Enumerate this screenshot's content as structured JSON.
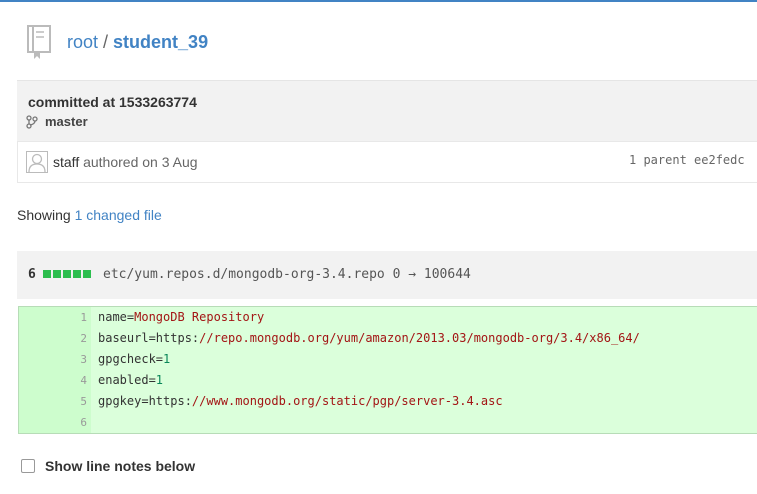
{
  "header": {
    "root": "root",
    "separator": "/",
    "repo": "student_39"
  },
  "commit": {
    "title": "committed at 1533263774",
    "branch": "master"
  },
  "meta": {
    "author": "staff",
    "authored": "authored on 3 Aug",
    "parents_label": "1 parent",
    "parent_hash": "ee2fedc"
  },
  "changes": {
    "prefix": "Showing",
    "link": "1 changed file"
  },
  "file": {
    "count": "6",
    "path": "etc/yum.repos.d/mongodb-org-3.4.repo",
    "mode": "0 → 100644"
  },
  "diff": {
    "lines": [
      {
        "n": "1",
        "key": "name=",
        "value": "MongoDB Repository"
      },
      {
        "n": "2",
        "key": "baseurl=https:",
        "value": "//repo.mongodb.org/yum/amazon/2013.03/mongodb-org/3.4/x86_64/"
      },
      {
        "n": "3",
        "key": "gpgcheck=",
        "value": "1"
      },
      {
        "n": "4",
        "key": "enabled=",
        "value": "1"
      },
      {
        "n": "5",
        "key": "gpgkey=https:",
        "value": "//www.mongodb.org/static/pgp/server-3.4.asc"
      },
      {
        "n": "6",
        "key": "",
        "value": ""
      }
    ]
  },
  "notes": {
    "label": "Show line notes below"
  },
  "colors": {
    "accent": "#4183c4",
    "added_bg": "#dbffdb",
    "diffstat": "#2cbe4e"
  }
}
